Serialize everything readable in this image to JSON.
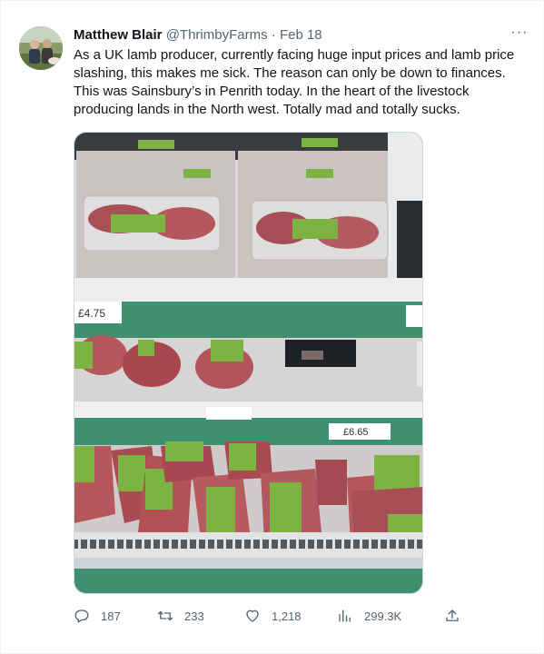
{
  "author": {
    "name": "Matthew Blair",
    "handle": "@ThrimbyFarms",
    "separator": "·",
    "date": "Feb 18"
  },
  "more_label": "···",
  "tweet_text": "As a UK lamb producer, currently facing huge input prices and lamb price slashing, this makes me sick. The reason can only be down to finances. This was Sainsbury’s in Penrith today. In the heart of the livestock producing lands in the North west. Totally mad and totally sucks.",
  "photo": {
    "price_tag_left": "£4.75",
    "price_tag_right": "£6.65",
    "colors": {
      "shelf_green": "#3f8f71",
      "meat": "#b85a5a",
      "label_green": "#7cb342"
    }
  },
  "actions": {
    "replies": "187",
    "retweets": "233",
    "likes": "1,218",
    "views": "299.3K"
  },
  "icons": [
    "reply-icon",
    "retweet-icon",
    "like-icon",
    "views-icon",
    "share-icon"
  ]
}
